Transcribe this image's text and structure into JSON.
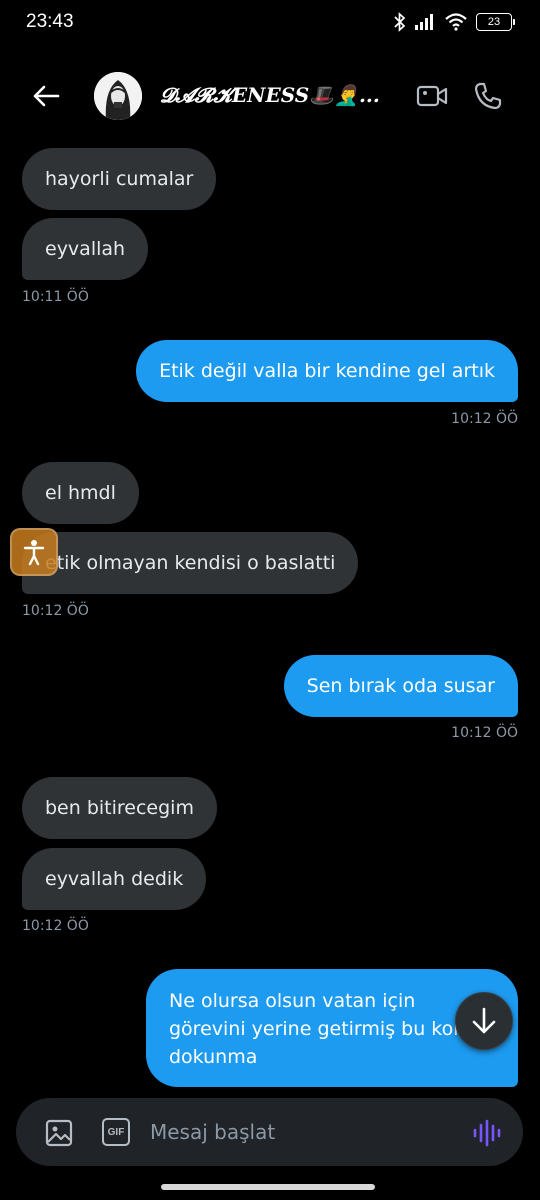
{
  "status_bar": {
    "time": "23:43",
    "battery": "23"
  },
  "header": {
    "back_icon": "arrow-left-icon",
    "contact_name": "𝓓𝓐𝓡𝓚ENESS🎩🤦‍♂️...",
    "video_icon": "video-camera-icon",
    "phone_icon": "phone-icon"
  },
  "messages": [
    {
      "side": "in",
      "text": "hayorli cumalar"
    },
    {
      "side": "in",
      "text": "eyvallah"
    },
    {
      "type": "timestamp",
      "text": "10:11 ÖÖ"
    },
    {
      "side": "out",
      "text": "Etik değil valla bir kendine gel artık"
    },
    {
      "type": "timestamp",
      "text": "10:12 ÖÖ"
    },
    {
      "side": "in",
      "text": "el hmdl"
    },
    {
      "side": "in",
      "text": "etik olmayan kendisi o baslatti"
    },
    {
      "type": "timestamp",
      "text": "10:12 ÖÖ"
    },
    {
      "side": "out",
      "text": "Sen bırak oda susar"
    },
    {
      "type": "timestamp",
      "text": "10:12 ÖÖ"
    },
    {
      "side": "in",
      "text": "ben bitirecegim"
    },
    {
      "side": "in",
      "text": "eyvallah dedik"
    },
    {
      "type": "timestamp",
      "text": "10:12 ÖÖ"
    },
    {
      "side": "out",
      "text": "Ne olursa olsun vatan için görevini yerine getirmiş bu kon dokunma"
    }
  ],
  "composer": {
    "placeholder": "Mesaj başlat",
    "gif_label": "GIF",
    "image_icon": "image-icon",
    "voice_icon": "voice-wave-icon"
  },
  "colors": {
    "outgoing_bubble": "#1d9bf0",
    "incoming_bubble": "#2f3336",
    "background": "#000000",
    "voice_accent": "#7856ff"
  }
}
